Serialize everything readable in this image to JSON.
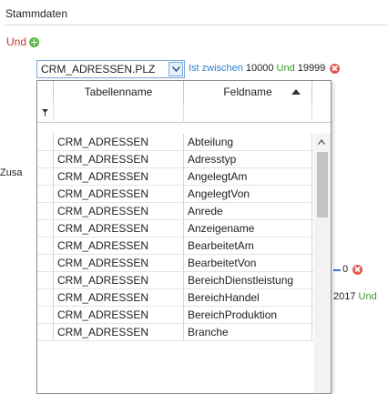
{
  "section": {
    "title": "Stammdaten"
  },
  "group": {
    "operator_label": "Und"
  },
  "condition": {
    "field_value": "CRM_ADRESSEN.PLZ",
    "operator": "Ist zwischen",
    "value_from": "10000",
    "joiner": "Und",
    "value_to": "19999"
  },
  "background": {
    "zusa_label": "Zusa",
    "zero_text": "0",
    "year_text": "2017",
    "year_joiner": "Und"
  },
  "popup": {
    "columns": {
      "table": "Tabellenname",
      "field": "Feldname"
    },
    "rows": [
      {
        "table": "CRM_ADRESSEN",
        "field": "Abteilung"
      },
      {
        "table": "CRM_ADRESSEN",
        "field": "Adresstyp"
      },
      {
        "table": "CRM_ADRESSEN",
        "field": "AngelegtAm"
      },
      {
        "table": "CRM_ADRESSEN",
        "field": "AngelegtVon"
      },
      {
        "table": "CRM_ADRESSEN",
        "field": "Anrede"
      },
      {
        "table": "CRM_ADRESSEN",
        "field": "Anzeigename"
      },
      {
        "table": "CRM_ADRESSEN",
        "field": "BearbeitetAm"
      },
      {
        "table": "CRM_ADRESSEN",
        "field": "BearbeitetVon"
      },
      {
        "table": "CRM_ADRESSEN",
        "field": "BereichDienstleistung"
      },
      {
        "table": "CRM_ADRESSEN",
        "field": "BereichHandel"
      },
      {
        "table": "CRM_ADRESSEN",
        "field": "BereichProduktion"
      },
      {
        "table": "CRM_ADRESSEN",
        "field": "Branche"
      }
    ]
  },
  "colors": {
    "und_red": "#c0392b",
    "add_green": "#5fb94a",
    "operator_blue": "#2f7fd0",
    "joiner_green": "#3a9a2c",
    "delete_red": "#e05a4f"
  },
  "icons": [
    "add-icon",
    "dropdown-arrow-icon",
    "delete-icon",
    "filter-icon",
    "sort-ascending-icon",
    "scroll-up-icon"
  ]
}
